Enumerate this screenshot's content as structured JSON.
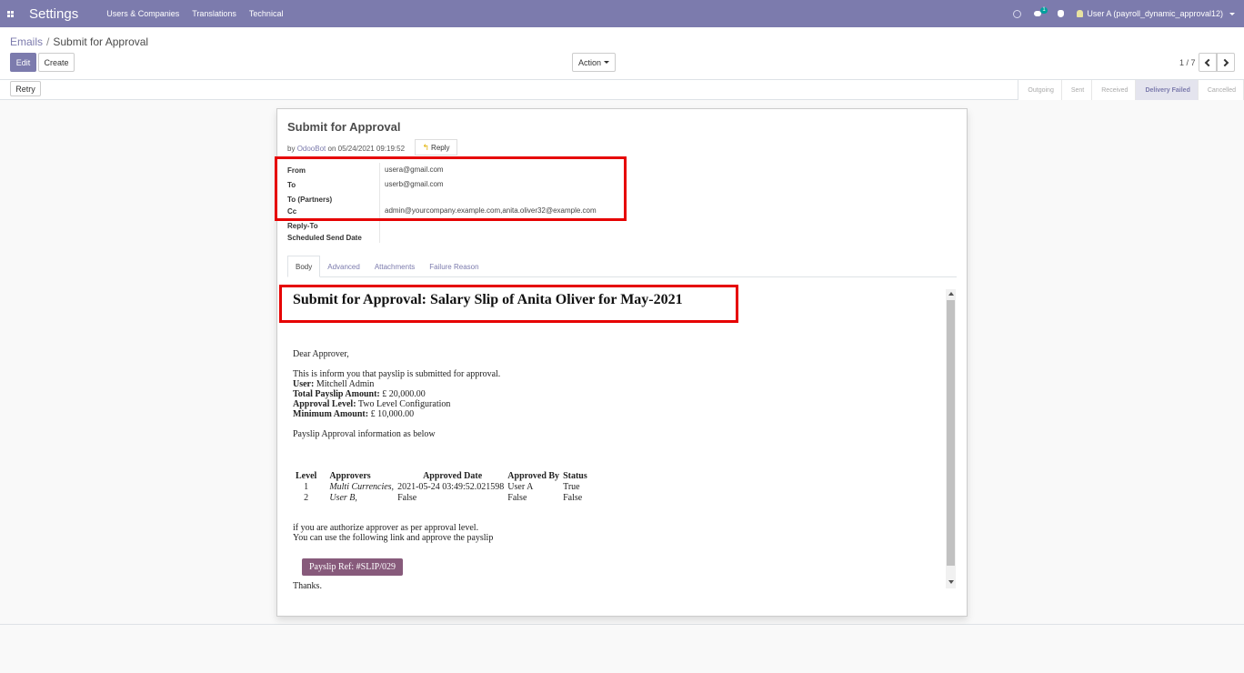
{
  "navbar": {
    "brand": "Settings",
    "menu": [
      "Users & Companies",
      "Translations",
      "Technical"
    ],
    "chat_badge": "1",
    "user": "User A (payroll_dynamic_approval12)"
  },
  "breadcrumb": {
    "parent": "Emails",
    "separator": "/",
    "current": "Submit for Approval"
  },
  "buttons": {
    "edit": "Edit",
    "create": "Create",
    "action": "Action",
    "retry": "Retry",
    "reply": "Reply"
  },
  "pager": {
    "value": "1 / 7"
  },
  "stages": [
    {
      "label": "Outgoing",
      "active": false
    },
    {
      "label": "Sent",
      "active": false
    },
    {
      "label": "Received",
      "active": false
    },
    {
      "label": "Delivery Failed",
      "active": true
    },
    {
      "label": "Cancelled",
      "active": false
    }
  ],
  "message": {
    "subject": "Submit for Approval",
    "by_prefix": "by",
    "author": "OdooBot",
    "date_text": "on 05/24/2021 09:19:52",
    "fields": {
      "from_label": "From",
      "from_value": "usera@gmail.com",
      "to_label": "To",
      "to_value": "userb@gmail.com",
      "to_partners_label": "To (Partners)",
      "cc_label": "Cc",
      "cc_value": "admin@yourcompany.example.com,anita.oliver32@example.com",
      "reply_to_label": "Reply-To",
      "scheduled_label": "Scheduled Send Date"
    },
    "tabs": [
      "Body",
      "Advanced",
      "Attachments",
      "Failure Reason"
    ]
  },
  "body": {
    "heading": "Submit for Approval: Salary Slip of Anita Oliver for May-2021",
    "greeting": "Dear Approver,",
    "intro": "This is inform you that payslip is submitted for approval.",
    "user_label": "User:",
    "user_value": "Mitchell Admin",
    "total_label": "Total Payslip Amount:",
    "total_value": "£ 20,000.00",
    "level_label": "Approval Level:",
    "level_value": "Two Level Configuration",
    "min_label": "Minimum Amount:",
    "min_value": "£ 10,000.00",
    "info_line": "Payslip Approval information as below",
    "table": {
      "headers": [
        "Level",
        "Approvers",
        "Approved Date",
        "Approved By",
        "Status"
      ],
      "rows": [
        [
          "1",
          "Multi Currencies,",
          "2021-05-24 03:49:52.021598",
          "User A",
          "True"
        ],
        [
          "2",
          "User B,",
          "False",
          "False",
          "False"
        ]
      ]
    },
    "note_1": "if you are authorize approver as per approval level.",
    "note_2": "You can use the following link and approve the payslip",
    "payslip_button": "Payslip Ref: #SLIP/029",
    "thanks": "Thanks."
  },
  "colors": {
    "brand": "#7c7bad",
    "payslip_button": "#875a7b",
    "annotation": "#e60000"
  }
}
